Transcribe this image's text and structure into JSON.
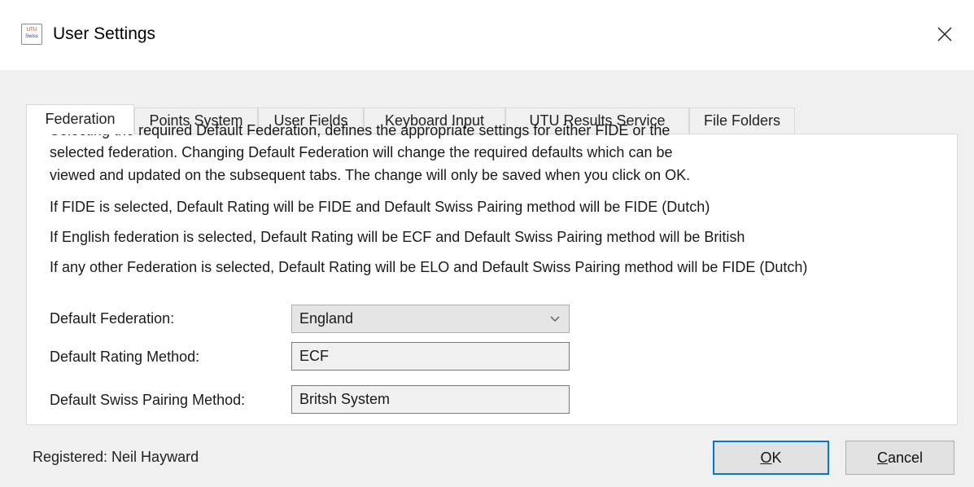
{
  "window": {
    "title": "User Settings",
    "icon_text_top": "UTU",
    "icon_text_bottom": "Swiss",
    "close_icon": "close-icon"
  },
  "tabs": [
    {
      "label": "Federation",
      "active": true
    },
    {
      "label": "Points System",
      "active": false
    },
    {
      "label": "User Fields",
      "active": false
    },
    {
      "label": "Keyboard Input",
      "active": false
    },
    {
      "label": "UTU Results Service",
      "active": false
    },
    {
      "label": "File Folders",
      "active": false
    }
  ],
  "federation": {
    "description": [
      "Selecting the required Default Federation, defines the appropriate settings for either FIDE or the",
      "selected federation. Changing Default Federation will change the required defaults which can be",
      "viewed and updated on the subsequent tabs. The change will only be saved when you click on OK."
    ],
    "rules": [
      "If FIDE is selected, Default Rating will be FIDE and Default Swiss Pairing method will be FIDE (Dutch)",
      "If English federation is selected, Default Rating will be ECF and Default Swiss Pairing method will be British",
      "If any other Federation is selected, Default Rating will be ELO and Default Swiss Pairing method will be FIDE (Dutch)"
    ],
    "default_federation_label": "Default Federation:",
    "default_federation_value": "England",
    "default_rating_label": "Default Rating Method:",
    "default_rating_value": "ECF",
    "default_pairing_label": "Default Swiss Pairing Method:",
    "default_pairing_value": "Britsh System"
  },
  "footer": {
    "registered": "Registered: Neil Hayward",
    "ok_prefix": "",
    "ok_mnemonic": "O",
    "ok_rest": "K",
    "cancel_mnemonic": "C",
    "cancel_rest": "ancel"
  },
  "colors": {
    "accent": "#0078d7",
    "background": "#f0f0f0",
    "panel": "#ffffff"
  }
}
